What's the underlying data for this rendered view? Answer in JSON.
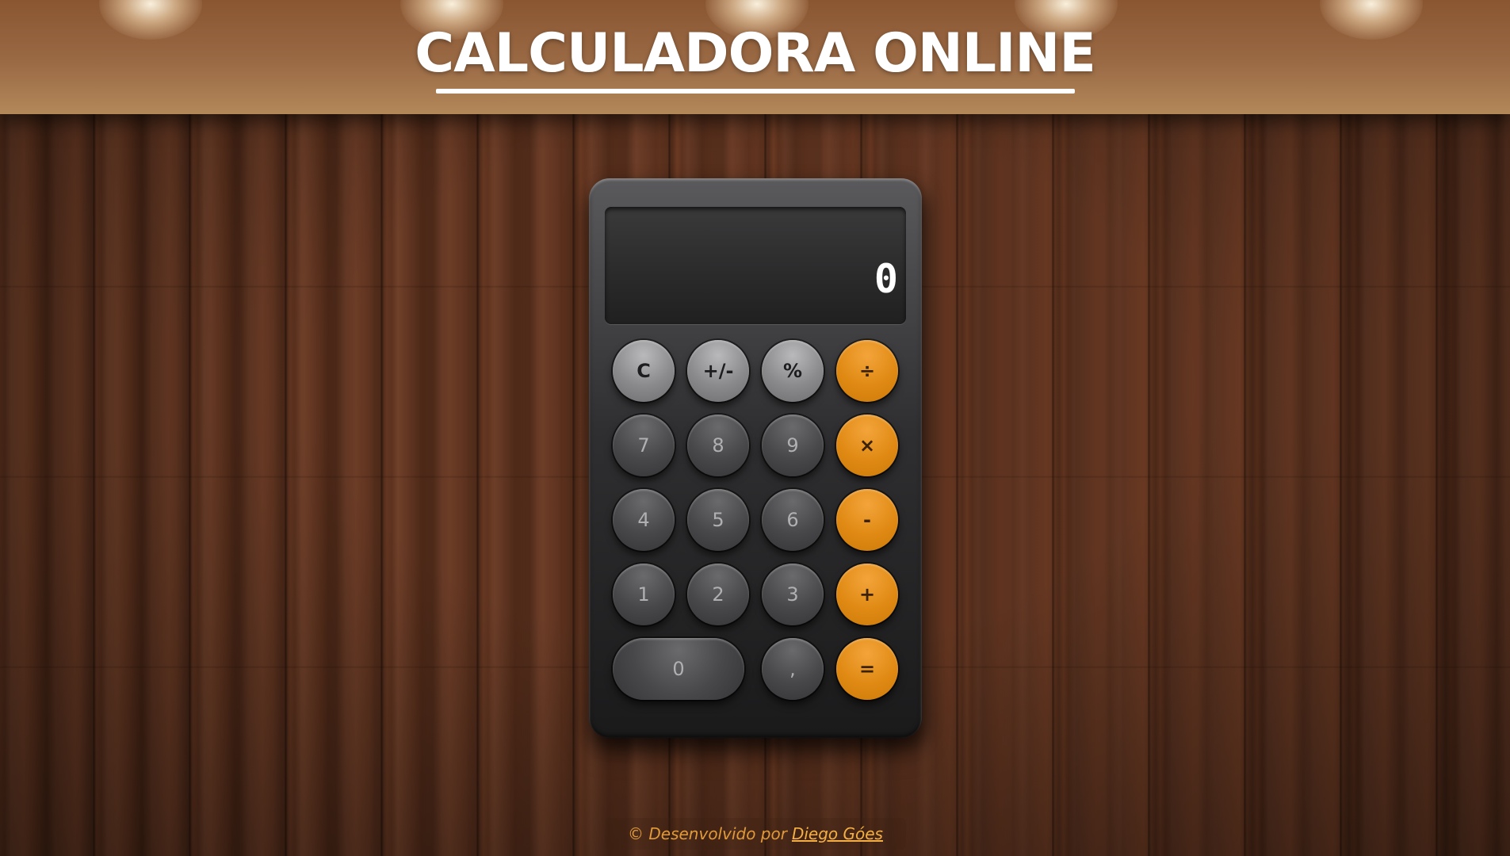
{
  "header": {
    "title": "CALCULADORA ONLINE"
  },
  "calculator": {
    "display": "0",
    "keys": {
      "clear": "C",
      "sign": "+/-",
      "percent": "%",
      "divide": "÷",
      "seven": "7",
      "eight": "8",
      "nine": "9",
      "multiply": "×",
      "four": "4",
      "five": "5",
      "six": "6",
      "subtract": "-",
      "one": "1",
      "two": "2",
      "three": "3",
      "add": "+",
      "zero": "0",
      "decimal": ",",
      "equals": "="
    }
  },
  "footer": {
    "text": "© Desenvolvido por",
    "author_link": "Diego Góes"
  },
  "colors": {
    "accent_orange": "#e08a14",
    "title_white": "#ffffff",
    "footer_text": "#e09a3a"
  }
}
